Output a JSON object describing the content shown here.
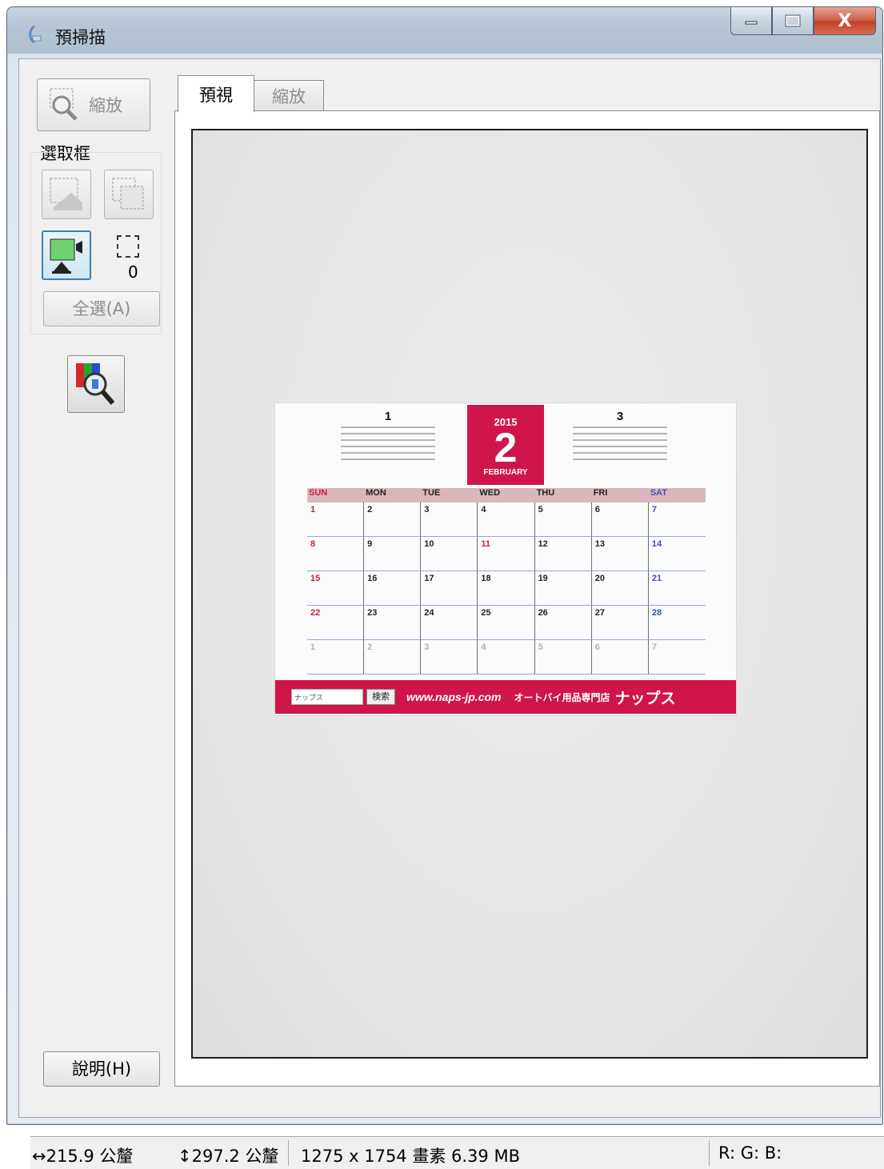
{
  "window": {
    "title": "預掃描",
    "close_glyph": "X"
  },
  "left_panel": {
    "zoom_button_label": "縮放",
    "marquee_group_title": "選取框",
    "marquee_count": "0",
    "select_all_label": "全選(A)",
    "help_label": "說明(H)"
  },
  "tabs": [
    {
      "label": "預視",
      "active": true
    },
    {
      "label": "縮放",
      "active": false
    }
  ],
  "scan": {
    "prev_month": "1",
    "next_month": "3",
    "year": "2015",
    "month_num": "2",
    "month_name": "FEBRUARY",
    "weekdays": [
      "SUN",
      "MON",
      "TUE",
      "WED",
      "THU",
      "FRI",
      "SAT"
    ],
    "days": [
      "1",
      "2",
      "3",
      "4",
      "5",
      "6",
      "7",
      "8",
      "9",
      "10",
      "11",
      "12",
      "13",
      "14",
      "15",
      "16",
      "17",
      "18",
      "19",
      "20",
      "21",
      "22",
      "23",
      "24",
      "25",
      "26",
      "27",
      "28",
      "1",
      "2",
      "3",
      "4",
      "5",
      "6",
      "7"
    ],
    "search_placeholder": "ナップス",
    "search_button": "検索",
    "url": "www.naps-jp.com",
    "shop_text": "オートバイ用品専門店",
    "brand": "ナップス",
    "colors": {
      "accent": "#d0154a",
      "sunday": "#c8203f",
      "saturday": "#3a55b0"
    }
  },
  "status": {
    "width": "215.9 公釐",
    "height": "297.2 公釐",
    "pixels": "1275 x 1754 畫素 6.39 MB",
    "rgb": "R: G: B:"
  },
  "icons": {
    "title": "scanner-icon",
    "zoom": "zoom-preview-icon",
    "color_palette": "color-palette-magnifier-icon"
  }
}
